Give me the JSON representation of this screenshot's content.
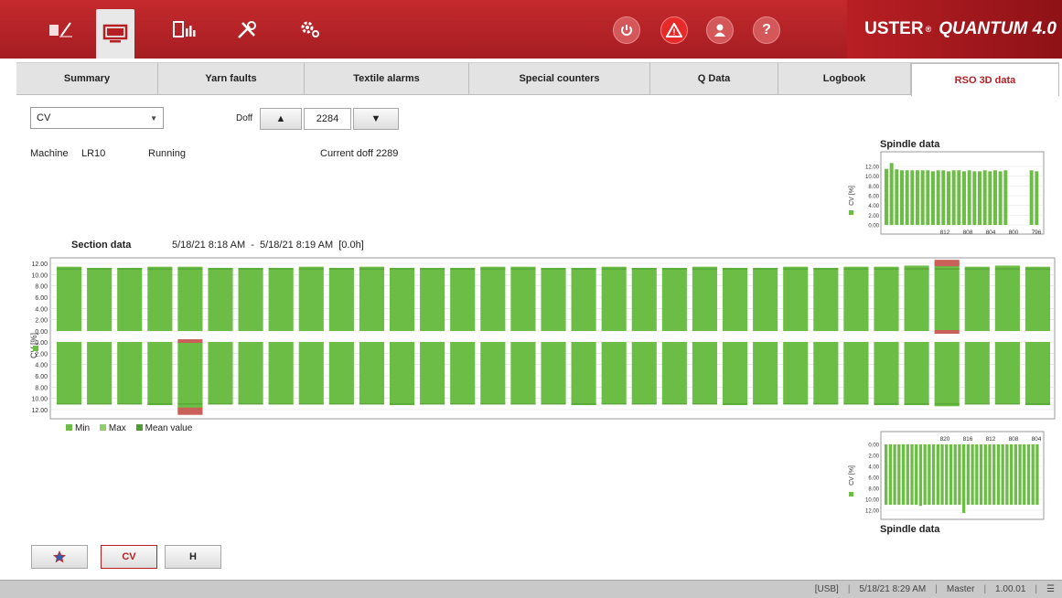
{
  "header": {
    "brand": "USTER",
    "brand_product": "QUANTUM 4.0",
    "nav_icons": [
      "logbook-pen-icon",
      "monitor-icon",
      "report-chart-icon",
      "tools-icon",
      "settings-gears-icon"
    ],
    "alarm_label": "!",
    "help_label": "?"
  },
  "tabs": [
    {
      "label": "Summary"
    },
    {
      "label": "Yarn faults"
    },
    {
      "label": "Textile alarms"
    },
    {
      "label": "Special counters"
    },
    {
      "label": "Q Data"
    },
    {
      "label": "Logbook"
    },
    {
      "label": "RSO 3D data",
      "active": true
    }
  ],
  "controls": {
    "measure_select": "CV",
    "doff_label": "Doff",
    "doff_value": "2284"
  },
  "info": {
    "machine_label": "Machine",
    "machine_value": "LR10",
    "state": "Running",
    "current_doff": "Current doff 2289"
  },
  "section": {
    "title": "Section data",
    "range": "5/18/21 8:18 AM  -  5/18/21 8:19 AM  [0.0h]"
  },
  "legend": {
    "min": "Min",
    "max": "Max",
    "mean": "Mean value"
  },
  "spindle": {
    "title": "Spindle data"
  },
  "bottom_buttons": {
    "cv": "CV",
    "h": "H"
  },
  "status": {
    "usb": "[USB]",
    "datetime": "5/18/21 8:29 AM",
    "role": "Master",
    "version": "1.00.01"
  },
  "colors": {
    "bar": "#6cbd45",
    "bar_dark": "#4f9c33",
    "alarm": "#c9615a",
    "accent": "#b62025"
  },
  "chart_data": [
    {
      "type": "bar",
      "title": "Section data",
      "ylabel": "CV [%]",
      "part": "upper",
      "yticks": [
        "12.00",
        "10.00",
        "8.00",
        "6.00",
        "4.00",
        "2.00",
        "0.00"
      ],
      "ylim": [
        0,
        12
      ],
      "values": [
        11.4,
        11.2,
        11.2,
        11.4,
        11.4,
        11.2,
        11.2,
        11.2,
        11.4,
        11.2,
        11.4,
        11.2,
        11.2,
        11.2,
        11.4,
        11.4,
        11.2,
        11.2,
        11.4,
        11.2,
        11.2,
        11.4,
        11.2,
        11.2,
        11.4,
        11.2,
        11.4,
        11.4,
        11.6,
        12.3,
        11.4,
        11.6,
        11.4
      ],
      "alarm_index": [
        29
      ]
    },
    {
      "type": "bar",
      "title": "Section data",
      "ylabel": "CV [%]",
      "part": "lower",
      "yticks": [
        "0.00",
        "2.00",
        "4.00",
        "6.00",
        "8.00",
        "10.00",
        "12.00"
      ],
      "ylim": [
        0,
        12
      ],
      "values": [
        11.0,
        11.0,
        11.0,
        11.2,
        12.6,
        11.0,
        11.0,
        11.0,
        11.0,
        11.0,
        11.0,
        11.2,
        11.0,
        11.0,
        11.0,
        11.0,
        11.0,
        11.2,
        11.0,
        11.0,
        11.0,
        11.0,
        11.2,
        11.0,
        11.0,
        11.0,
        11.0,
        11.2,
        11.2,
        11.4,
        11.0,
        11.0,
        11.2
      ],
      "alarm_index": [
        4
      ]
    },
    {
      "type": "bar",
      "title": "Spindle data",
      "ylabel": "CV [%]",
      "part": "top",
      "yticks": [
        "12.00",
        "10.00",
        "8.00",
        "6.00",
        "4.00",
        "2.00",
        "0.00"
      ],
      "xticks": [
        "812",
        "808",
        "804",
        "800",
        "796"
      ],
      "ylim": [
        0,
        12
      ],
      "values": [
        11.5,
        12.7,
        11.4,
        11.2,
        11.2,
        11.2,
        11.2,
        11.2,
        11.2,
        11.0,
        11.2,
        11.2,
        11.0,
        11.2,
        11.2,
        11.0,
        11.2,
        11.0,
        11.0,
        11.2,
        11.0,
        11.2,
        11.0,
        11.2,
        0,
        0,
        0,
        0,
        11.2,
        11.0
      ]
    },
    {
      "type": "bar",
      "title": "Spindle data",
      "ylabel": "CV [%]",
      "part": "bottom",
      "yticks": [
        "0.00",
        "2.00",
        "4.00",
        "6.00",
        "8.00",
        "10.00",
        "12.00"
      ],
      "xticks": [
        "820",
        "816",
        "812",
        "808",
        "804"
      ],
      "ylim": [
        0,
        12
      ],
      "values": [
        11.0,
        11.0,
        11.0,
        11.0,
        11.0,
        11.0,
        11.0,
        11.0,
        11.2,
        11.0,
        11.0,
        11.0,
        11.0,
        11.0,
        11.0,
        11.0,
        11.0,
        11.0,
        12.5,
        11.0,
        11.0,
        11.0,
        11.0,
        11.0,
        11.0,
        11.0,
        11.0,
        11.0,
        11.0,
        11.0,
        11.0,
        11.0,
        11.0,
        11.0,
        11.0,
        11.0
      ]
    }
  ]
}
